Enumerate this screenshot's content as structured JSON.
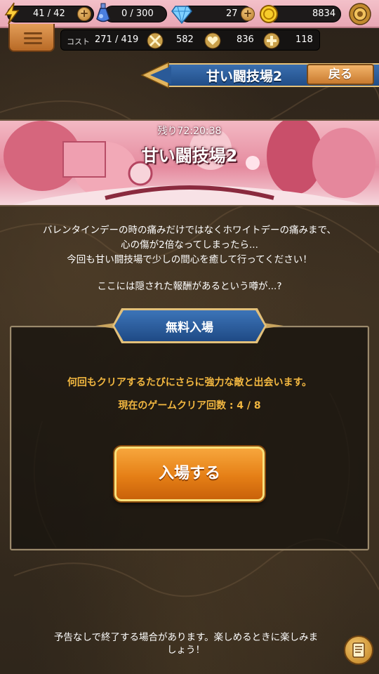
{
  "resources": {
    "stamina": "41 / 42",
    "potion": "0 / 300",
    "gems": "27",
    "coins": "8834"
  },
  "stats": {
    "cost_label": "コスト",
    "cost_value": "271 / 419",
    "attack": "582",
    "hp": "836",
    "heal": "118"
  },
  "header": {
    "title": "甘い闘技場2",
    "back_label": "戻る"
  },
  "event": {
    "timer": "残り72:20:38",
    "name": "甘い闘技場2"
  },
  "description": {
    "line1": "バレンタインデーの時の痛みだけではなくホワイトデーの痛みまで、",
    "line2": "心の傷が2倍なってしまったら...",
    "line3": "今回も甘い闘技場で少しの間心を癒して行ってください！",
    "line4": "ここには隠された報酬があるという噂が...?"
  },
  "panel": {
    "tab_label": "無料入場",
    "info": "何回もクリアするたびにさらに強力な敵と出会います。",
    "clear_count": "現在のゲームクリア回数 : 4 / 8",
    "enter_label": "入場する"
  },
  "footer": {
    "line1": "予告なしで終了する場合があります。楽しめるときに楽しみま",
    "line2": "しょう！"
  },
  "icons": {
    "stamina": "lightning-icon",
    "potion": "potion-icon",
    "gems": "diamond-icon",
    "coins": "coin-icon",
    "settings": "gear-icon",
    "attack": "crossed-swords-icon",
    "hp": "heart-icon",
    "heal": "cross-icon"
  },
  "colors": {
    "topbar": "#e9a7b4",
    "banner_blue": "#2a5a98",
    "accent_gold": "#f2b740",
    "button_orange": "#e57f16"
  }
}
